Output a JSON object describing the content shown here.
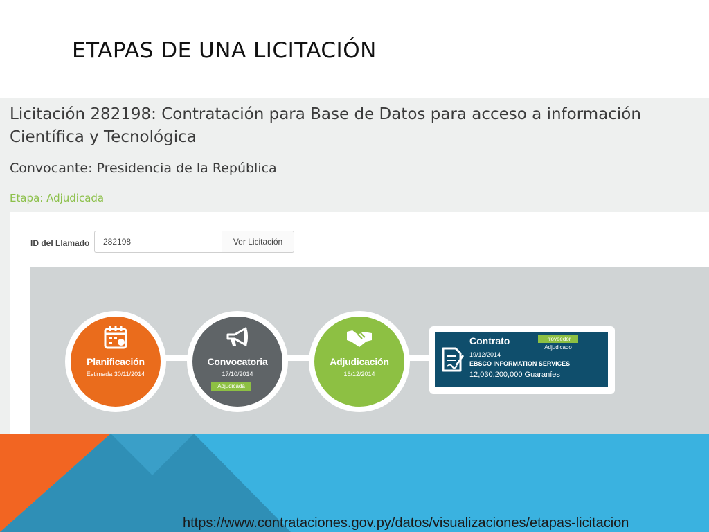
{
  "slide": {
    "title": "ETAPAS DE UNA LICITACIÓN",
    "url": "https://www.contrataciones.gov.py/datos/visualizaciones/etapas-licitacion"
  },
  "page": {
    "title": "Licitación 282198: Contratación para Base de Datos para acceso a información Científica y Tecnológica",
    "convocante": "Convocante: Presidencia de la República",
    "etapa": "Etapa: Adjudicada"
  },
  "search": {
    "label": "ID del Llamado",
    "value": "282198",
    "button": "Ver Licitación"
  },
  "stages": [
    {
      "name": "Planificación",
      "date": "Estimada 30/11/2014",
      "icon": "calendar-icon",
      "color": "#ea6c1c"
    },
    {
      "name": "Convocatoria",
      "date": "17/10/2014",
      "badge": "Adjudicada",
      "icon": "megaphone-icon",
      "color": "#5f6467"
    },
    {
      "name": "Adjudicación",
      "date": "16/12/2014",
      "icon": "handshake-icon",
      "color": "#8dc043"
    }
  ],
  "contract": {
    "name": "Contrato",
    "date": "19/12/2014",
    "supplier": "EBSCO INFORMATION SERVICES",
    "amount": "12,030,200,000 Guaraníes",
    "badge": "Proveedor",
    "badge_sub": "Adjudicado",
    "icon": "document-sign-icon",
    "color": "#0f4e6c"
  },
  "colors": {
    "accent_green": "#8dc043",
    "band_blue": "#3ab2e0",
    "band_orange": "#f26522"
  }
}
